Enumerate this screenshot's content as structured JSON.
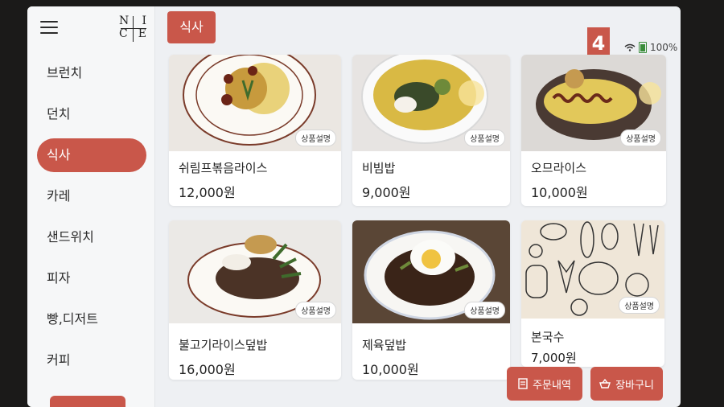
{
  "brand": {
    "logo_letters": [
      "N",
      "I",
      "C",
      "E"
    ]
  },
  "sidebar": {
    "items": [
      {
        "label": "브런치",
        "active": false
      },
      {
        "label": "던치",
        "active": false
      },
      {
        "label": "식사",
        "active": true
      },
      {
        "label": "카레",
        "active": false
      },
      {
        "label": "샌드위치",
        "active": false
      },
      {
        "label": "피자",
        "active": false
      },
      {
        "label": "빵,디저트",
        "active": false
      },
      {
        "label": "커피",
        "active": false
      }
    ]
  },
  "header": {
    "tab_label": "식사",
    "cart_count": "4",
    "battery": "100%"
  },
  "menu": {
    "items": [
      {
        "name": "쉬림프볶음라이스",
        "price": "12,000원",
        "desc_label": "상품설명",
        "icon": "shrimp-fried-rice-photo"
      },
      {
        "name": "비빔밥",
        "price": "9,000원",
        "desc_label": "상품설명",
        "icon": "bibimbap-photo"
      },
      {
        "name": "오므라이스",
        "price": "10,000원",
        "desc_label": "상품설명",
        "icon": "omurice-photo"
      },
      {
        "name": "불고기라이스덮밥",
        "price": "16,000원",
        "desc_label": "상품설명",
        "icon": "bulgogi-rice-bowl-photo"
      },
      {
        "name": "제육덮밥",
        "price": "10,000원",
        "desc_label": "상품설명",
        "icon": "jeyuk-rice-bowl-photo"
      },
      {
        "name": "본국수",
        "price": "7,000원",
        "desc_label": "상품설명",
        "icon": "vegetable-illustration-placeholder"
      }
    ]
  },
  "footer": {
    "order_history_label": "주문내역",
    "cart_label": "장바구니"
  },
  "colors": {
    "accent": "#c9574a",
    "background": "#eef0f3"
  }
}
